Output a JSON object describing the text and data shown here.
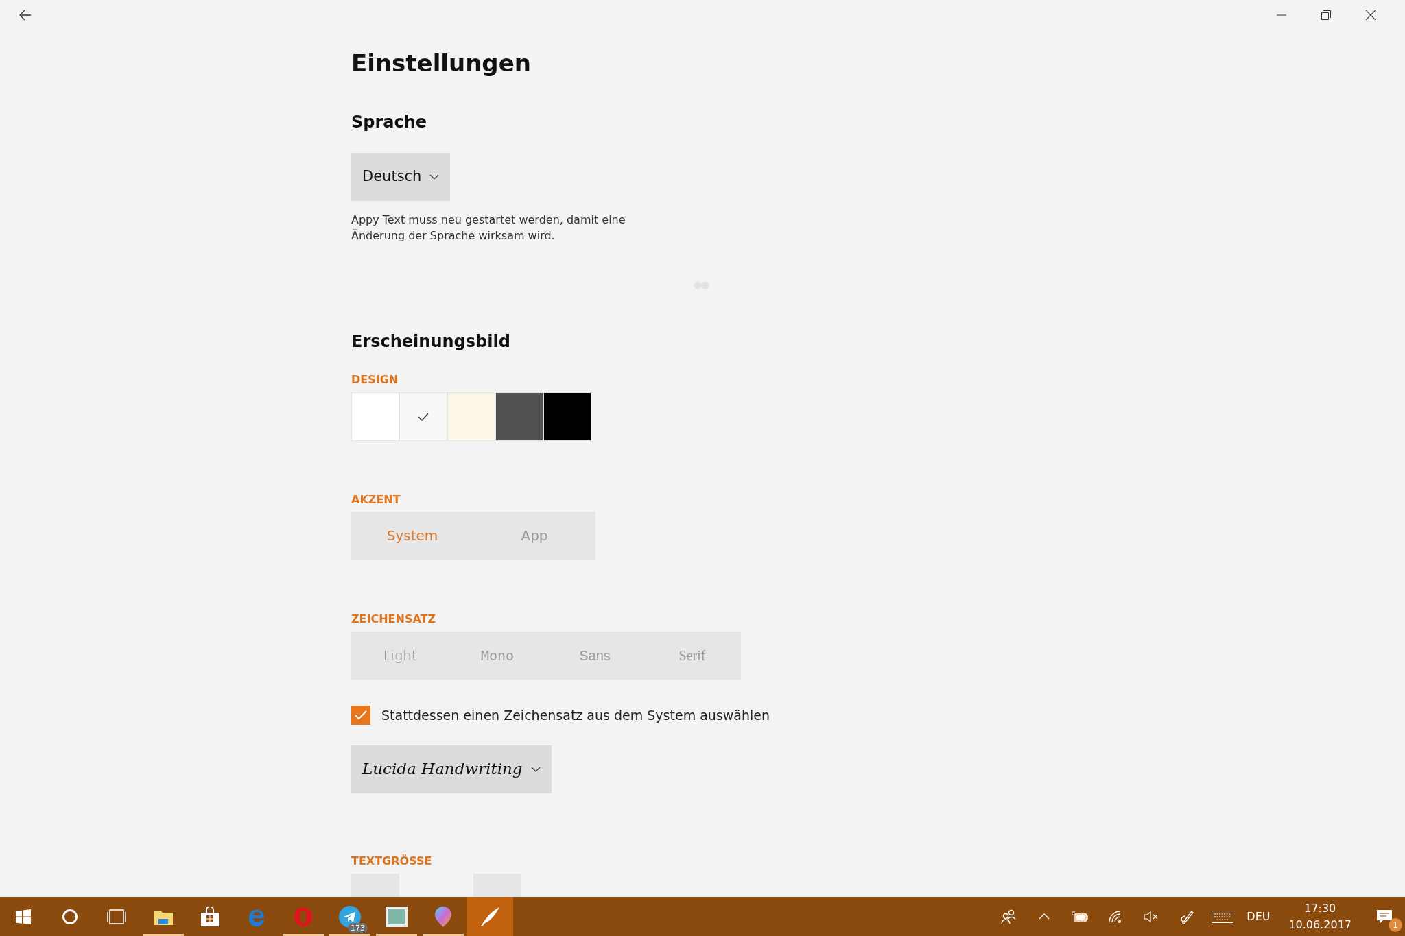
{
  "title": "Einstellungen",
  "language": {
    "heading": "Sprache",
    "dropdown": {
      "value": "Deutsch"
    },
    "note": "Appy Text muss neu gestartet werden, damit eine Änderung der Sprache wirksam wird."
  },
  "appearance": {
    "heading": "Erscheinungsbild",
    "design": {
      "label": "DESIGN",
      "themes": [
        {
          "color": "#ffffff",
          "selected": false
        },
        {
          "color": "#f7f7f7",
          "selected": true
        },
        {
          "color": "#fbf6e8",
          "selected": false
        },
        {
          "color": "#525252",
          "selected": false
        },
        {
          "color": "#000000",
          "selected": false
        }
      ]
    },
    "accent": {
      "label": "AKZENT",
      "disabled": true,
      "options": [
        {
          "label": "System",
          "selected": true
        },
        {
          "label": "App",
          "selected": false
        }
      ]
    },
    "font": {
      "label": "ZEICHENSATZ",
      "disabled": true,
      "options": [
        {
          "label": "Light",
          "selected": false
        },
        {
          "label": "Mono",
          "selected": false
        },
        {
          "label": "Sans",
          "selected": false
        },
        {
          "label": "Serif",
          "selected": false
        }
      ],
      "system_font": {
        "label": "Stattdessen einen Zeichensatz aus dem System auswählen",
        "checked": true
      },
      "dropdown": {
        "value": "Lucida Handwriting"
      }
    },
    "text_size": {
      "label": "TEXTGRÖSSE"
    }
  },
  "taskbar": {
    "apps": [
      {
        "running": true,
        "active": false
      },
      {
        "running": false,
        "active": false
      },
      {
        "running": false,
        "active": false
      },
      {
        "running": true,
        "active": false
      },
      {
        "running": true,
        "active": false,
        "badge": "173"
      },
      {
        "running": true,
        "active": false
      },
      {
        "running": true,
        "active": false
      },
      {
        "running": true,
        "active": true
      }
    ],
    "language": "DEU",
    "time": "17:30",
    "date": "10.06.2017",
    "notification_count": "1"
  }
}
